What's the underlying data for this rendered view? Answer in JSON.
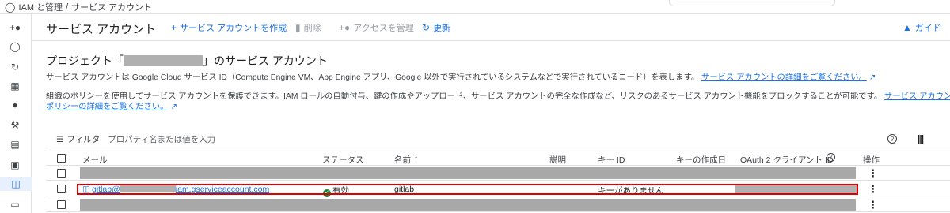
{
  "breadcrumb": {
    "root": "IAM と管理",
    "sep": "/",
    "current": "サービス アカウント"
  },
  "header": {
    "title": "サービス アカウント",
    "create_label": "サービス アカウントを作成",
    "delete_label": "削除",
    "access_label": "アクセスを管理",
    "refresh_label": "更新",
    "guide_label": "ガイド"
  },
  "intro": {
    "title_prefix": "プロジェクト「",
    "title_suffix": "」のサービス アカウント",
    "p1": "サービス アカウントは Google Cloud サービス ID（Compute Engine VM、App Engine アプリ、Google 以外で実行されているシステムなどで実行されているコード）を表します。",
    "p1_link": "サービス アカウントの詳細をご覧ください。",
    "p2": "組織のポリシーを使用してサービス アカウントを保護できます。IAM ロールの自動付与、鍵の作成やアップロード、サービス アカウントの完全な作成など、リスクのあるサービス アカウント機能をブロックすることが可能です。",
    "p2_link_a": "サービス アカウントの組織の",
    "p2_link_b": "ポリシーの詳細をご覧ください。"
  },
  "filter": {
    "label": "フィルタ",
    "placeholder": "プロパティ名または値を入力",
    "help_icon": "?"
  },
  "table": {
    "columns": {
      "email": "メール",
      "status": "ステータス",
      "name": "名前",
      "sort": "↑",
      "description": "説明",
      "key_id": "キー ID",
      "key_created": "キーの作成日",
      "oauth": "OAuth 2 クライアント ID",
      "actions": "操作"
    },
    "highlighted_row": {
      "email_prefix": "gitlab@",
      "email_suffix": "iam.gserviceaccount.com",
      "status": "有効",
      "name": "gitlab",
      "key_id": "キーがありません"
    }
  },
  "colors": {
    "accent": "#1a73e8",
    "highlight": "#e00000",
    "ok": "#188038"
  }
}
